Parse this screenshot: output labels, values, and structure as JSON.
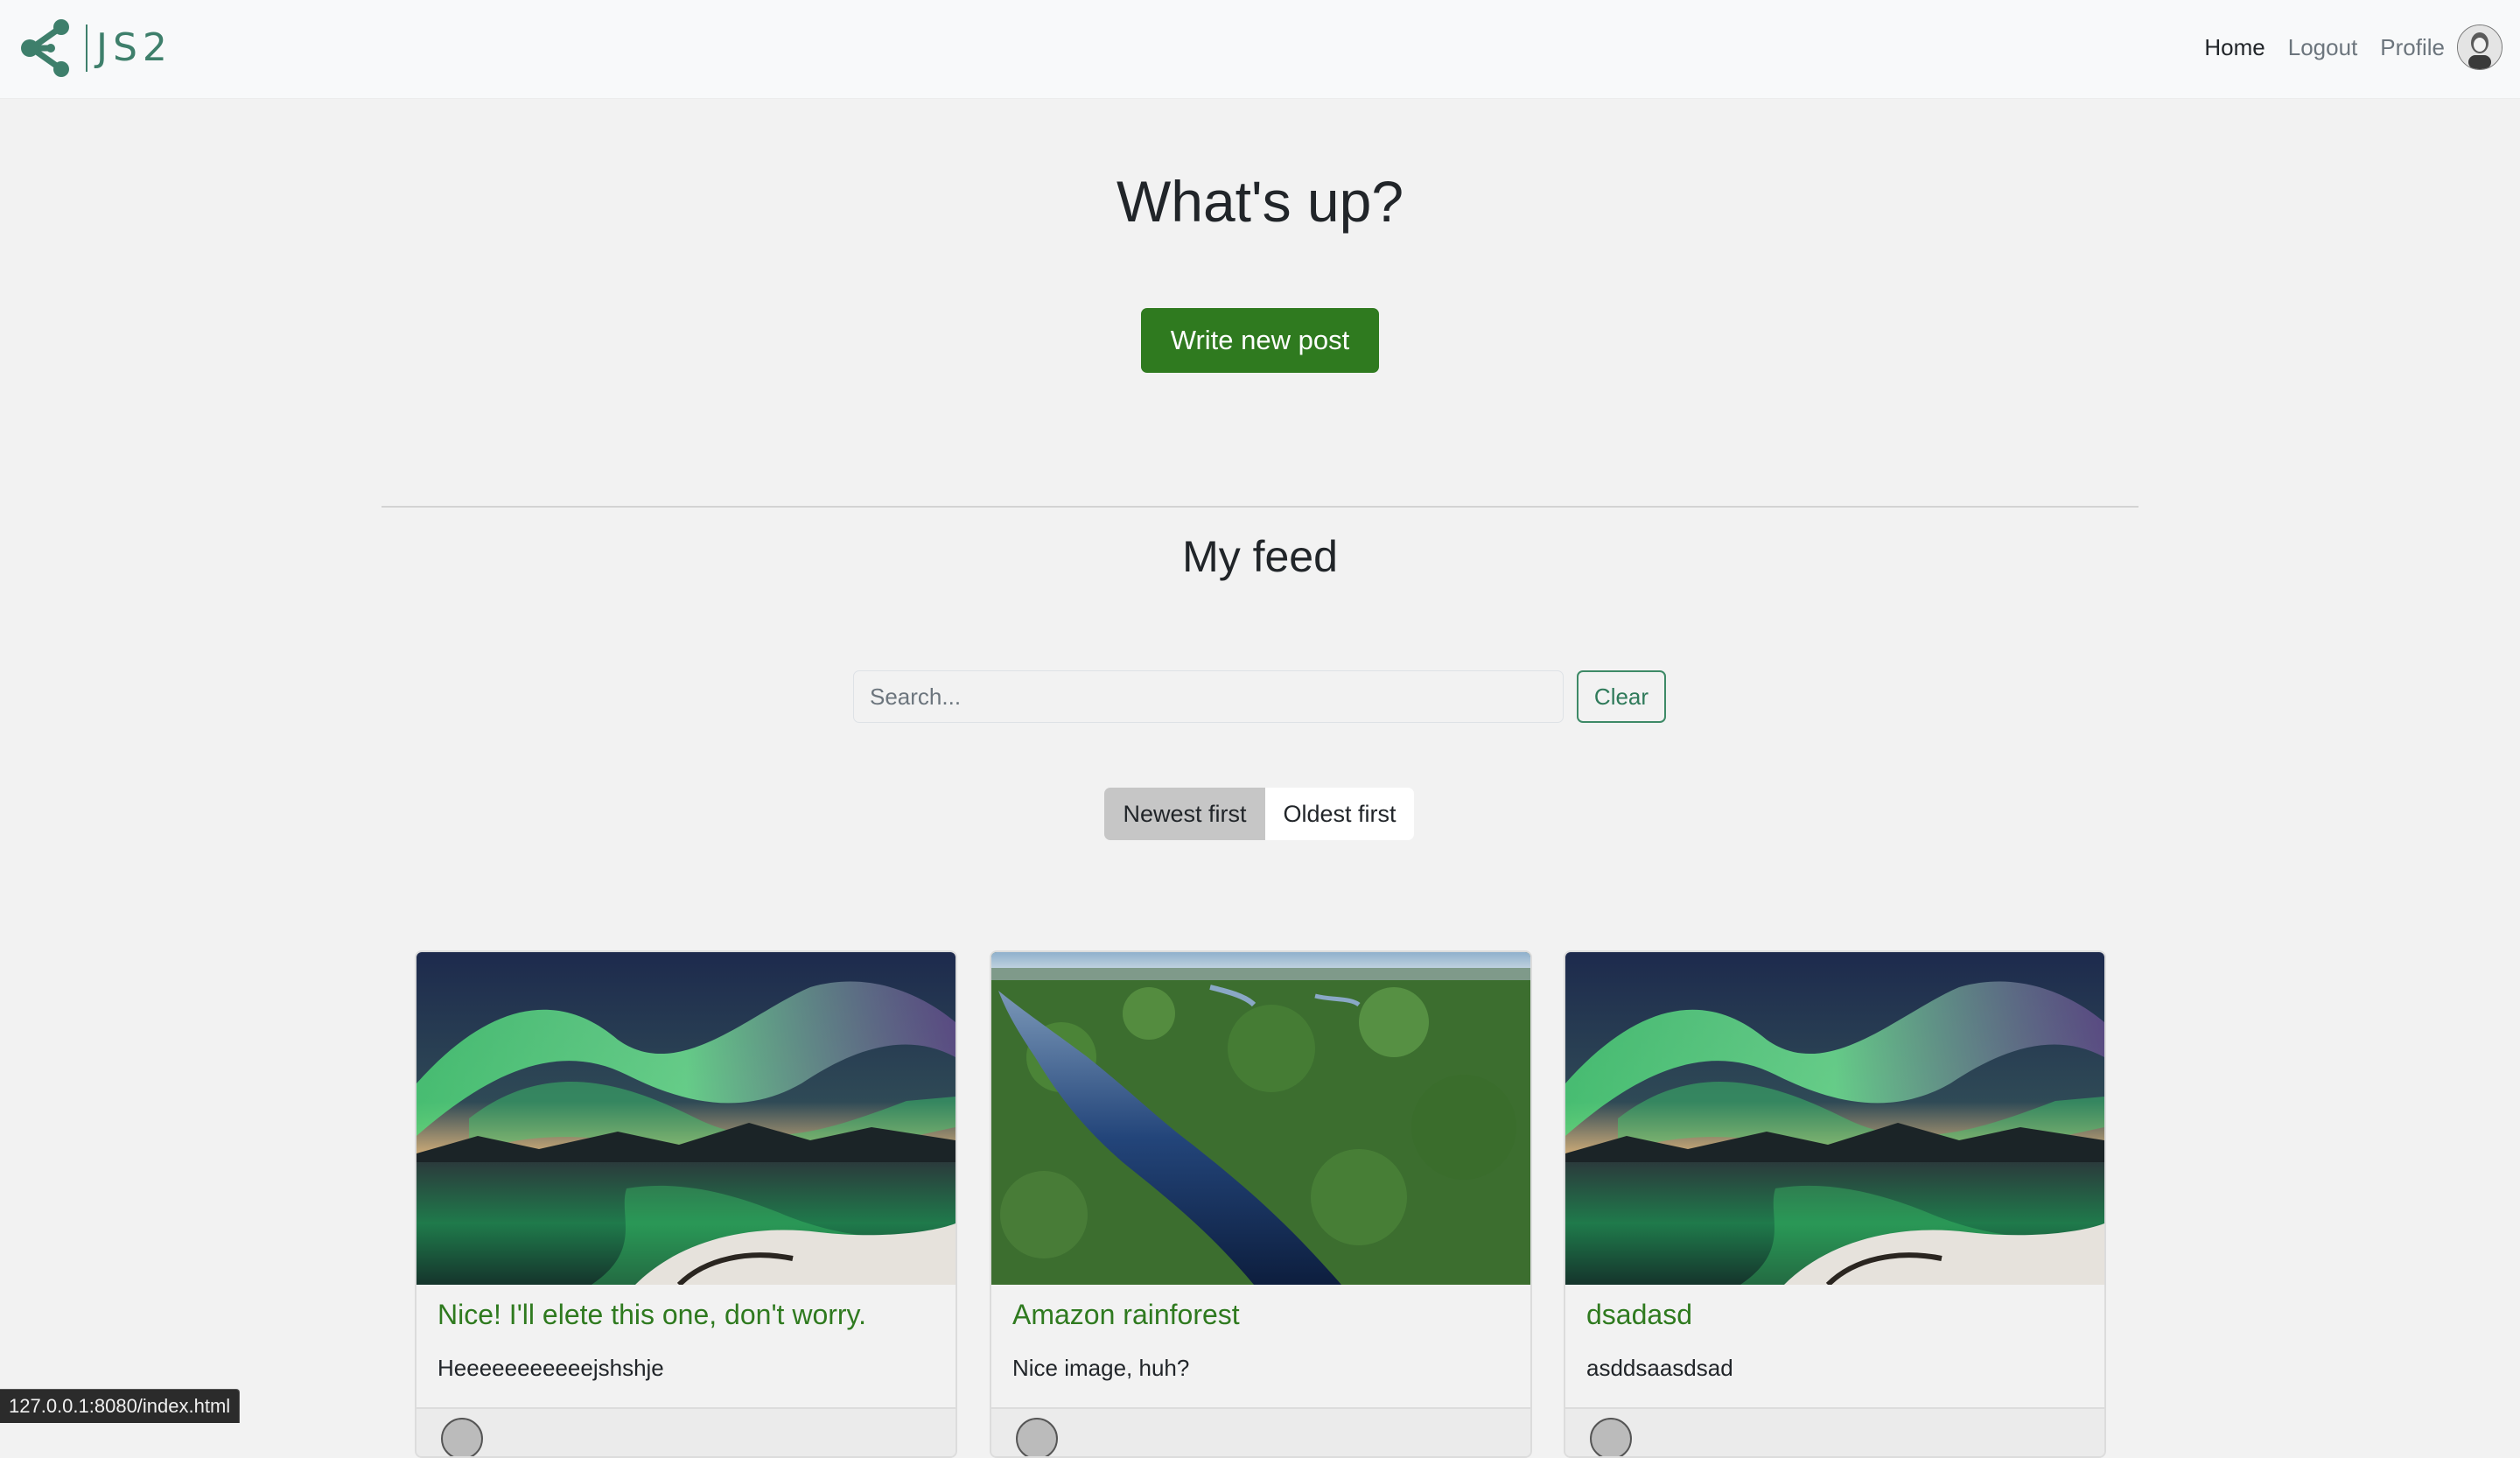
{
  "nav": {
    "brand_text": "JS2",
    "links": {
      "home": "Home",
      "logout": "Logout",
      "profile": "Profile"
    }
  },
  "hero": {
    "title": "What's up?",
    "new_post_label": "Write new post"
  },
  "feed": {
    "title": "My feed",
    "search": {
      "placeholder": "Search...",
      "value": "",
      "clear_label": "Clear"
    },
    "sort": {
      "newest_label": "Newest first",
      "oldest_label": "Oldest first",
      "selected": "newest"
    },
    "posts": [
      {
        "title": "Nice! I'll elete this one, don't worry.",
        "body": "Heeeeeeeeeeejshshje",
        "image": "aurora"
      },
      {
        "title": "Amazon rainforest",
        "body": "Nice image, huh?",
        "image": "rainforest-river"
      },
      {
        "title": "dsadasd",
        "body": "asddsaasdsad",
        "image": "aurora"
      }
    ]
  },
  "status_bar": {
    "url": "127.0.0.1:8080/index.html"
  },
  "colors": {
    "brand": "#3e7f6b",
    "primary_button": "#2f7a1f",
    "post_title": "#2f7a1f",
    "background": "#f2f2f2"
  }
}
